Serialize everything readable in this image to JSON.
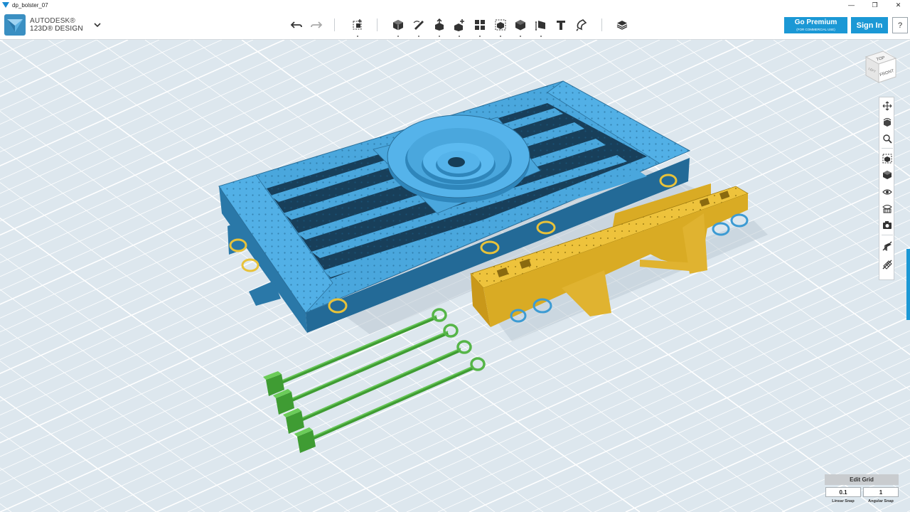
{
  "window": {
    "title": "dp_bolster_07",
    "minimize": "—",
    "maximize": "❐",
    "close": "✕"
  },
  "brand": {
    "line1": "AUTODESK®",
    "line2": "123D® DESIGN"
  },
  "toolbar": {
    "tools": [
      "undo-icon",
      "redo-icon",
      "transform-icon",
      "primitives-icon",
      "sketch-icon",
      "construct-icon",
      "modify-icon",
      "pattern-icon",
      "grouping-icon",
      "combine-icon",
      "measure-icon",
      "text-icon",
      "snap-icon",
      "material-icon"
    ]
  },
  "account": {
    "premium_label": "Go Premium",
    "premium_sub": "(FOR COMMERCIAL USE)",
    "signin_label": "Sign In",
    "help_label": "?"
  },
  "viewcube": {
    "top": "TOP",
    "front": "FRONT",
    "left": "LEFT"
  },
  "nav": {
    "items": [
      "pan-icon",
      "orbit-icon",
      "zoom-icon",
      "fit-icon",
      "views-icon",
      "visibility-icon",
      "materials-outline-icon",
      "screenshot-icon",
      "hide-sketch-icon",
      "hide-mesh-icon"
    ]
  },
  "grid": {
    "edit_label": "Edit Grid",
    "linear_value": "0.1",
    "angular_value": "1",
    "linear_label": "Linear Snap",
    "angular_label": "Angular Snap"
  },
  "colors": {
    "accent": "#1b98d5",
    "part_blue": "#4aa7dd",
    "part_yellow": "#eec33c",
    "part_green": "#56b548",
    "grid_bg": "#dde7ee"
  }
}
